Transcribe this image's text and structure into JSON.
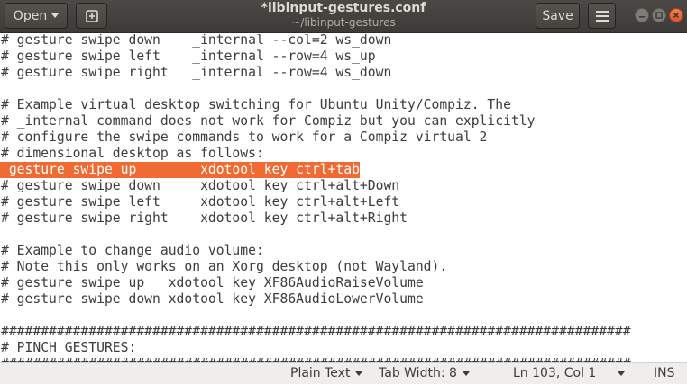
{
  "header": {
    "open_label": "Open",
    "title": "*libinput-gestures.conf",
    "subtitle": "~/libinput-gestures",
    "save_label": "Save"
  },
  "editor": {
    "lines": [
      "# gesture swipe down    _internal --col=2 ws_down",
      "# gesture swipe left    _internal --row=4 ws_up",
      "# gesture swipe right   _internal --row=4 ws_down",
      "",
      "# Example virtual desktop switching for Ubuntu Unity/Compiz. The",
      "# _internal command does not work for Compiz but you can explicitly",
      "# configure the swipe commands to work for a Compiz virtual 2",
      "# dimensional desktop as follows:",
      " gesture swipe up        xdotool key ctrl+tab",
      "# gesture swipe down     xdotool key ctrl+alt+Down",
      "# gesture swipe left     xdotool key ctrl+alt+Left",
      "# gesture swipe right    xdotool key ctrl+alt+Right",
      "",
      "# Example to change audio volume:",
      "# Note this only works on an Xorg desktop (not Wayland).",
      "# gesture swipe up   xdotool key XF86AudioRaiseVolume",
      "# gesture swipe down xdotool key XF86AudioLowerVolume",
      "",
      "###############################################################################",
      "# PINCH GESTURES:",
      "###############################################################################"
    ]
  },
  "statusbar": {
    "language": "Plain Text",
    "tab_width": "Tab Width: 8",
    "position": "Ln 103, Col 1",
    "mode": "INS"
  },
  "colors": {
    "selection": "#ef6b33",
    "headerbar": "#3c3b37",
    "close_button": "#e1542a"
  }
}
